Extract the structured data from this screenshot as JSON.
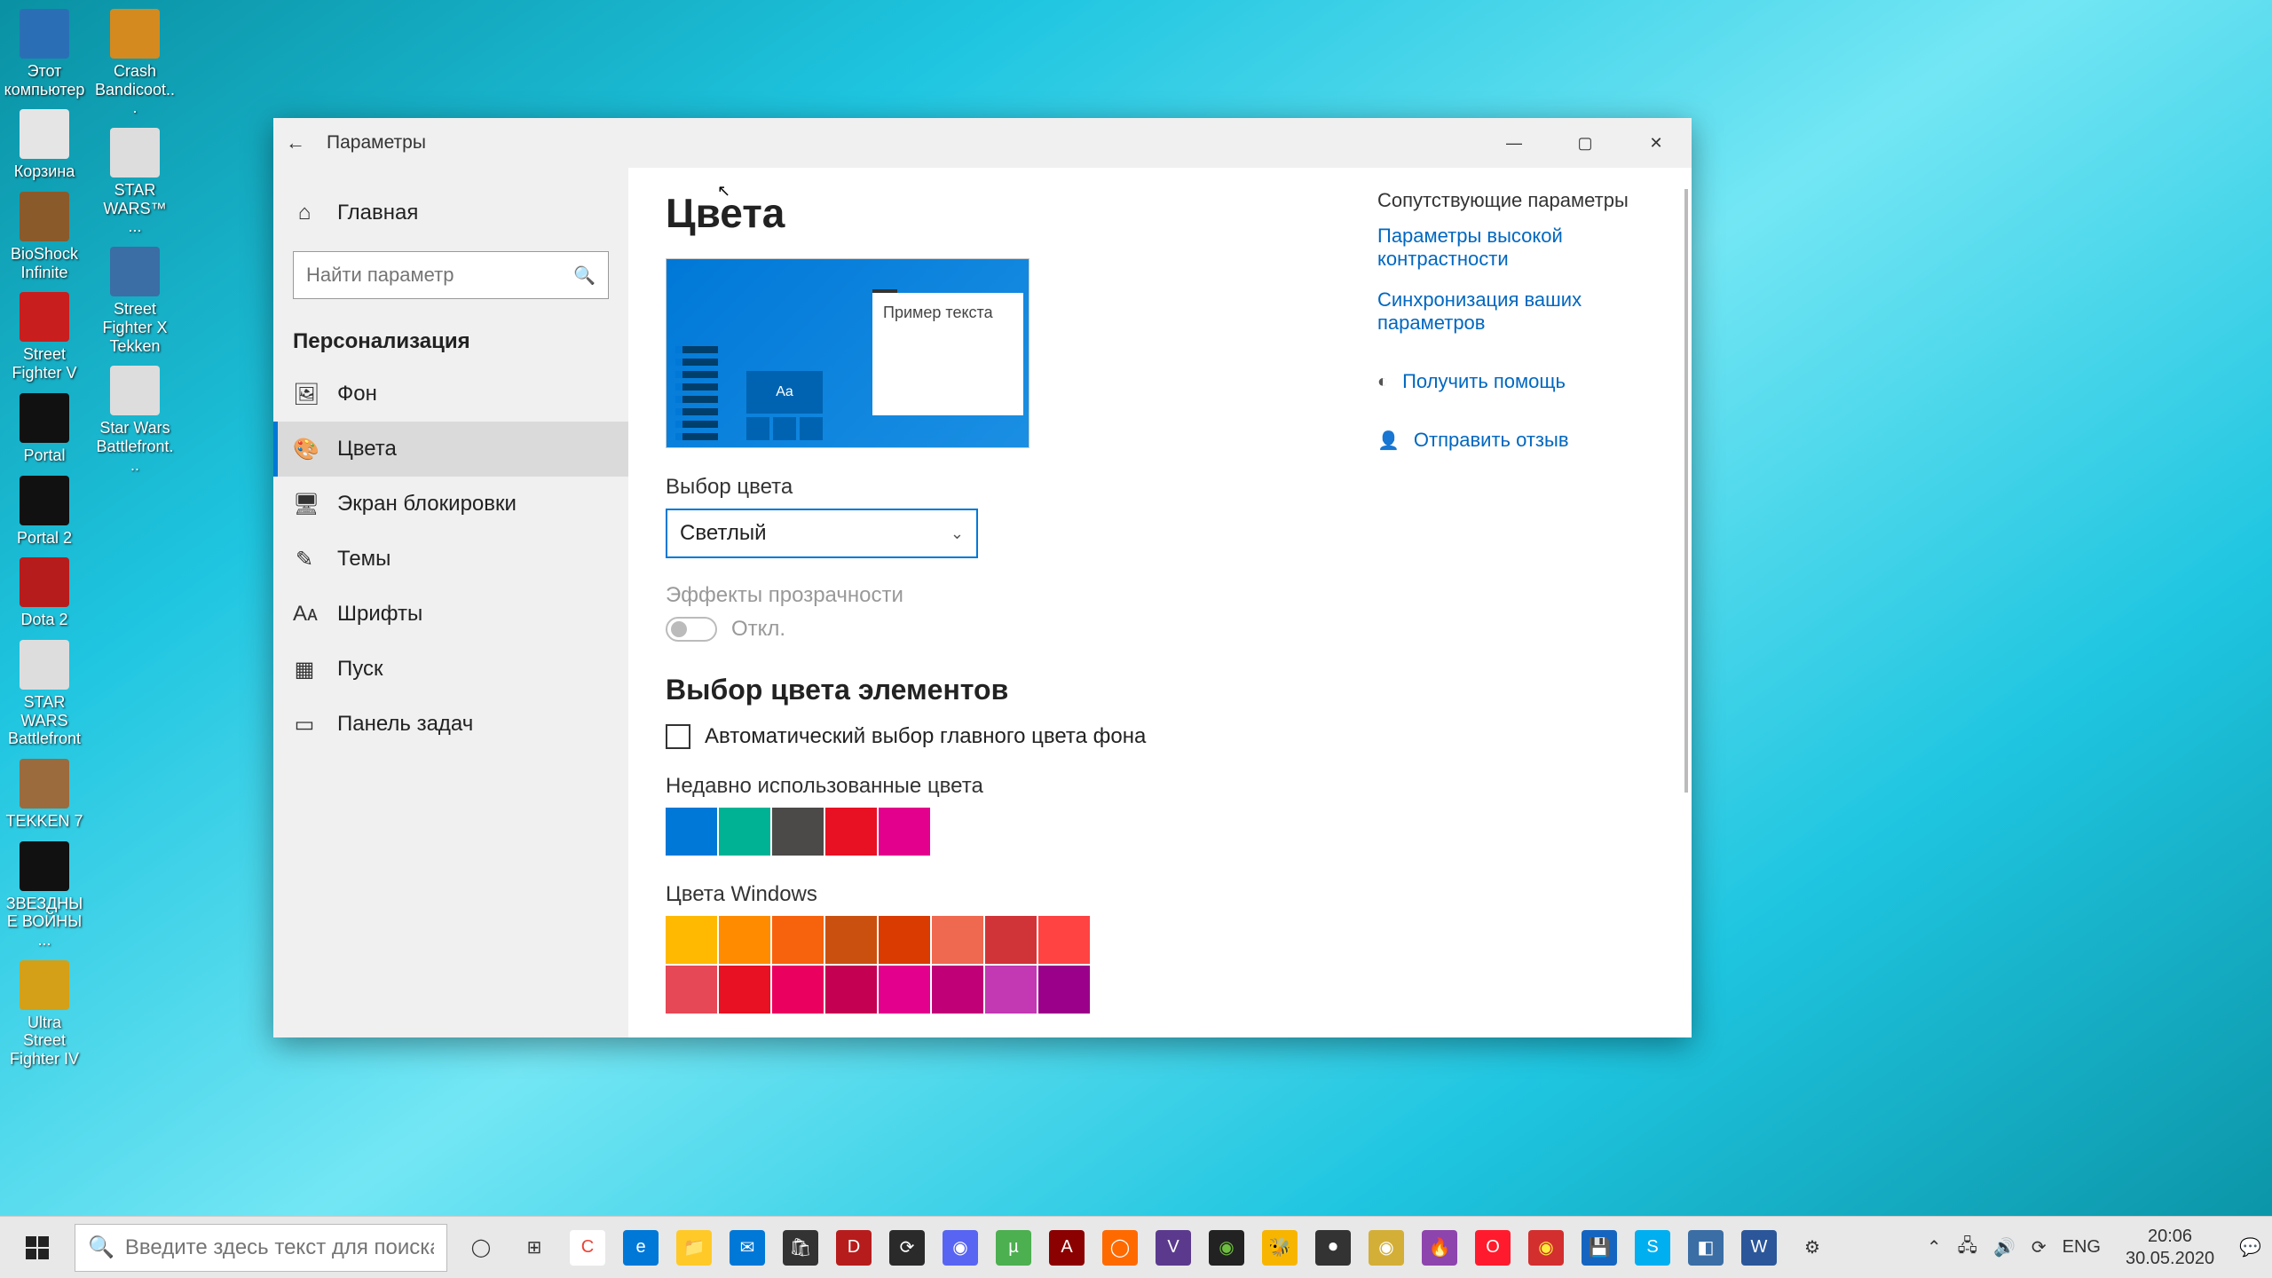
{
  "desktop_icons_left": [
    {
      "label": "Этот компьютер",
      "bg": "#2a6fb5"
    },
    {
      "label": "Корзина",
      "bg": "#e5e5e5"
    },
    {
      "label": "BioShock Infinite",
      "bg": "#8a5a2b"
    },
    {
      "label": "Street Fighter V",
      "bg": "#c81e1e"
    },
    {
      "label": "Portal",
      "bg": "#111"
    },
    {
      "label": "Portal 2",
      "bg": "#111"
    },
    {
      "label": "Dota 2",
      "bg": "#b71c1c"
    },
    {
      "label": "STAR WARS Battlefront",
      "bg": "#ddd"
    },
    {
      "label": "TEKKEN 7",
      "bg": "#9b6b3d"
    },
    {
      "label": "ЗВЕЗДНЫЕ ВОЙНЫ ...",
      "bg": "#111"
    },
    {
      "label": "Ultra Street Fighter IV",
      "bg": "#d4a017"
    }
  ],
  "desktop_icons_right": [
    {
      "label": "Crash Bandicoot...",
      "bg": "#d48a1f"
    },
    {
      "label": "STAR WARS™ ...",
      "bg": "#ddd"
    },
    {
      "label": "Street Fighter X Tekken",
      "bg": "#3a6ea5"
    },
    {
      "label": "Star Wars Battlefront...",
      "bg": "#ddd"
    }
  ],
  "window": {
    "title": "Параметры",
    "sidebar_home": "Главная",
    "search_placeholder": "Найти параметр",
    "sidebar_section": "Персонализация",
    "sidebar_items": [
      {
        "icon": "🖼",
        "label": "Фон"
      },
      {
        "icon": "🎨",
        "label": "Цвета"
      },
      {
        "icon": "🖥",
        "label": "Экран блокировки"
      },
      {
        "icon": "✎",
        "label": "Темы"
      },
      {
        "icon": "Aᴀ",
        "label": "Шрифты"
      },
      {
        "icon": "▦",
        "label": "Пуск"
      },
      {
        "icon": "▭",
        "label": "Панель задач"
      }
    ],
    "active_sidebar_index": 1
  },
  "main": {
    "heading": "Цвета",
    "preview_sample": "Пример текста",
    "preview_aa": "Aa",
    "color_mode_label": "Выбор цвета",
    "color_mode_value": "Светлый",
    "transparency_label": "Эффекты прозрачности",
    "transparency_state": "Откл.",
    "accent_heading": "Выбор цвета элементов",
    "auto_checkbox": "Автоматический выбор главного цвета фона",
    "recent_colors_label": "Недавно использованные цвета",
    "recent_colors": [
      "#0078d7",
      "#00b294",
      "#4c4a48",
      "#e81123",
      "#e3008c"
    ],
    "windows_colors_label": "Цвета Windows",
    "windows_colors_row1": [
      "#ffb900",
      "#ff8c00",
      "#f7630c",
      "#ca5010",
      "#da3b01",
      "#ef6950",
      "#d13438",
      "#ff4343"
    ],
    "windows_colors_row2": [
      "#e74856",
      "#e81123",
      "#ea005e",
      "#c30052",
      "#e3008c",
      "#bf0077",
      "#c239b3",
      "#9a0089"
    ]
  },
  "related": {
    "title": "Сопутствующие параметры",
    "link1": "Параметры высокой контрастности",
    "link2": "Синхронизация ваших параметров",
    "help": "Получить помощь",
    "feedback": "Отправить отзыв"
  },
  "taskbar": {
    "search_placeholder": "Введите здесь текст для поиска",
    "apps": [
      {
        "bg": "transparent",
        "txt": "◯",
        "color": "#333"
      },
      {
        "bg": "transparent",
        "txt": "⊞",
        "color": "#333"
      },
      {
        "bg": "#fff",
        "txt": "C",
        "color": "#ea4335"
      },
      {
        "bg": "#0078d7",
        "txt": "e",
        "color": "#fff"
      },
      {
        "bg": "#ffca28",
        "txt": "📁",
        "color": "#333"
      },
      {
        "bg": "#0078d7",
        "txt": "✉",
        "color": "#fff"
      },
      {
        "bg": "#333",
        "txt": "🛍",
        "color": "#fff"
      },
      {
        "bg": "#b71c1c",
        "txt": "D",
        "color": "#fff"
      },
      {
        "bg": "#2a2a2a",
        "txt": "⟳",
        "color": "#fff"
      },
      {
        "bg": "#5865f2",
        "txt": "◉",
        "color": "#fff"
      },
      {
        "bg": "#4caf50",
        "txt": "µ",
        "color": "#fff"
      },
      {
        "bg": "#8b0000",
        "txt": "A",
        "color": "#fff"
      },
      {
        "bg": "#ff6a00",
        "txt": "◯",
        "color": "#fff"
      },
      {
        "bg": "#5b3a8e",
        "txt": "V",
        "color": "#fff"
      },
      {
        "bg": "#222",
        "txt": "◉",
        "color": "#6fbf3f"
      },
      {
        "bg": "#f7b500",
        "txt": "🐝",
        "color": "#333"
      },
      {
        "bg": "#333",
        "txt": "⏺",
        "color": "#fff"
      },
      {
        "bg": "#d4af37",
        "txt": "◉",
        "color": "#fff"
      },
      {
        "bg": "#8e44ad",
        "txt": "🔥",
        "color": "#fff"
      },
      {
        "bg": "#ff1b2d",
        "txt": "O",
        "color": "#fff"
      },
      {
        "bg": "#d32f2f",
        "txt": "◉",
        "color": "#ffeb3b"
      },
      {
        "bg": "#1565c0",
        "txt": "💾",
        "color": "#fff"
      },
      {
        "bg": "#00aff0",
        "txt": "S",
        "color": "#fff"
      },
      {
        "bg": "#3a6ea5",
        "txt": "◧",
        "color": "#fff"
      },
      {
        "bg": "#2b579a",
        "txt": "W",
        "color": "#fff"
      },
      {
        "bg": "transparent",
        "txt": "⚙",
        "color": "#333"
      }
    ],
    "tray": {
      "lang": "ENG",
      "time": "20:06",
      "date": "30.05.2020"
    }
  }
}
